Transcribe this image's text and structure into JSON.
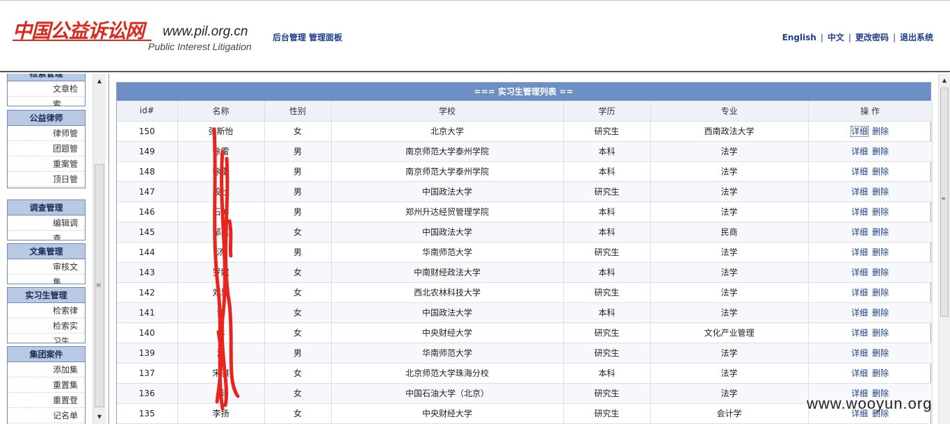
{
  "header": {
    "logo_cn": "中国公益诉讼网",
    "logo_url": "www.pil.org.cn",
    "logo_en": "Public Interest Litigation",
    "title": "后台管理 管理面板",
    "nav": [
      {
        "label": "English"
      },
      {
        "label": "中文"
      },
      {
        "label": "更改密码"
      },
      {
        "label": "退出系统"
      }
    ]
  },
  "sidebar": {
    "groups": [
      {
        "title": "检索管理",
        "items": [
          "文章检索"
        ]
      },
      {
        "title": "公益律师",
        "items": [
          "律师管",
          "团题管",
          "重案管",
          "顶日管理"
        ]
      },
      {
        "title": "调查管理",
        "items": [
          "编辑调查"
        ]
      },
      {
        "title": "文集管理",
        "items": [
          "审核文集"
        ]
      },
      {
        "title": "实习生管理",
        "items": [
          "检索律",
          "检索实习生"
        ]
      },
      {
        "title": "集团案件",
        "items": [
          "添加集",
          "重置集",
          "重置登",
          "记名单"
        ]
      }
    ]
  },
  "list": {
    "title": "=== 实习生管理列表 ==",
    "columns": [
      "id#",
      "名称",
      "性别",
      "学校",
      "学历",
      "专业",
      "操 作"
    ],
    "rows": [
      {
        "id": "150",
        "name": "张斯怡",
        "gender": "女",
        "school": "北京大学",
        "degree": "研究生",
        "major": "西南政法大学"
      },
      {
        "id": "149",
        "name": "徐雷",
        "gender": "男",
        "school": "南京师范大学泰州学院",
        "degree": "本科",
        "major": "法学"
      },
      {
        "id": "148",
        "name": "徐雷",
        "gender": "男",
        "school": "南京师范大学泰州学院",
        "degree": "本科",
        "major": "法学"
      },
      {
        "id": "147",
        "name": "段壮",
        "gender": "男",
        "school": "中国政法大学",
        "degree": "研究生",
        "major": "法学"
      },
      {
        "id": "146",
        "name": "石帅",
        "gender": "男",
        "school": "郑州升达经贸管理学院",
        "degree": "本科",
        "major": "法学"
      },
      {
        "id": "145",
        "name": "邹真",
        "gender": "女",
        "school": "中国政法大学",
        "degree": "本科",
        "major": "民商"
      },
      {
        "id": "144",
        "name": "汤",
        "gender": "男",
        "school": "华南师范大学",
        "degree": "研究生",
        "major": "法学"
      },
      {
        "id": "143",
        "name": "罗妮",
        "gender": "女",
        "school": "中南财经政法大学",
        "degree": "本科",
        "major": "法学"
      },
      {
        "id": "142",
        "name": "刘思",
        "gender": "女",
        "school": "西北农林科技大学",
        "degree": "研究生",
        "major": "法学"
      },
      {
        "id": "141",
        "name": "谢",
        "gender": "女",
        "school": "中国政法大学",
        "degree": "本科",
        "major": "法学"
      },
      {
        "id": "140",
        "name": "林",
        "gender": "女",
        "school": "中央财经大学",
        "degree": "研究生",
        "major": "文化产业管理"
      },
      {
        "id": "139",
        "name": "汤",
        "gender": "男",
        "school": "华南师范大学",
        "degree": "研究生",
        "major": "法学"
      },
      {
        "id": "137",
        "name": "宋骐",
        "gender": "女",
        "school": "北京师范大学珠海分校",
        "degree": "本科",
        "major": "法学"
      },
      {
        "id": "136",
        "name": "菲",
        "gender": "女",
        "school": "中国石油大学（北京）",
        "degree": "研究生",
        "major": "法学"
      },
      {
        "id": "135",
        "name": "李扬",
        "gender": "女",
        "school": "中央财经大学",
        "degree": "研究生",
        "major": "会计学"
      }
    ],
    "ops": {
      "detail": "详细",
      "delete": "删除"
    }
  },
  "watermark": "www.wooyun.org",
  "colors": {
    "logo_red": "#d92a1c",
    "nav_blue": "#1f3e8c",
    "list_header": "#6e8fc4",
    "redaction": "#e8241c"
  }
}
